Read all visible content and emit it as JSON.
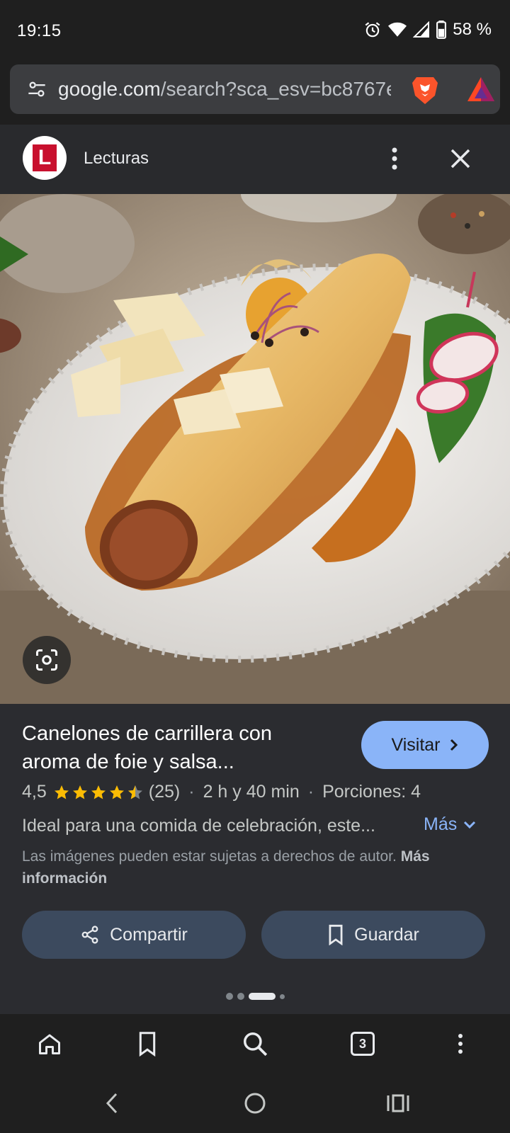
{
  "status_bar": {
    "time": "19:15",
    "battery": "58 %"
  },
  "url_bar": {
    "domain": "google.com",
    "path": "/search?sca_esv=bc8767e"
  },
  "source": {
    "logo_letter": "L",
    "name": "Lecturas"
  },
  "recipe": {
    "title": "Canelones de carrillera con aroma de foie y salsa...",
    "visit_label": "Visitar",
    "rating": "4,5",
    "rating_value": 4.5,
    "reviews": "(25)",
    "time": "2 h y 40 min",
    "servings": "Porciones: 4",
    "description": "Ideal para una comida de celebración, este...",
    "more_label": "Más",
    "copyright_text": "Las imágenes pueden estar sujetas a derechos de autor.",
    "copyright_link": "Más información",
    "share_label": "Compartir",
    "save_label": "Guardar"
  },
  "pagination": {
    "total": 4,
    "active": 3
  },
  "toolbar": {
    "tab_count": "3"
  },
  "colors": {
    "accent": "#8ab4f8",
    "star": "#fbbc04",
    "logo_red": "#c8102e"
  },
  "icons": [
    "tune-icon",
    "brave-lion-icon",
    "bat-triangle-icon",
    "more-vert-icon",
    "close-icon",
    "lens-icon",
    "star-icon",
    "chevron-right-icon",
    "chevron-down-icon",
    "share-icon",
    "bookmark-icon",
    "home-icon",
    "search-icon",
    "tabs-icon",
    "back-icon",
    "recents-icon"
  ]
}
